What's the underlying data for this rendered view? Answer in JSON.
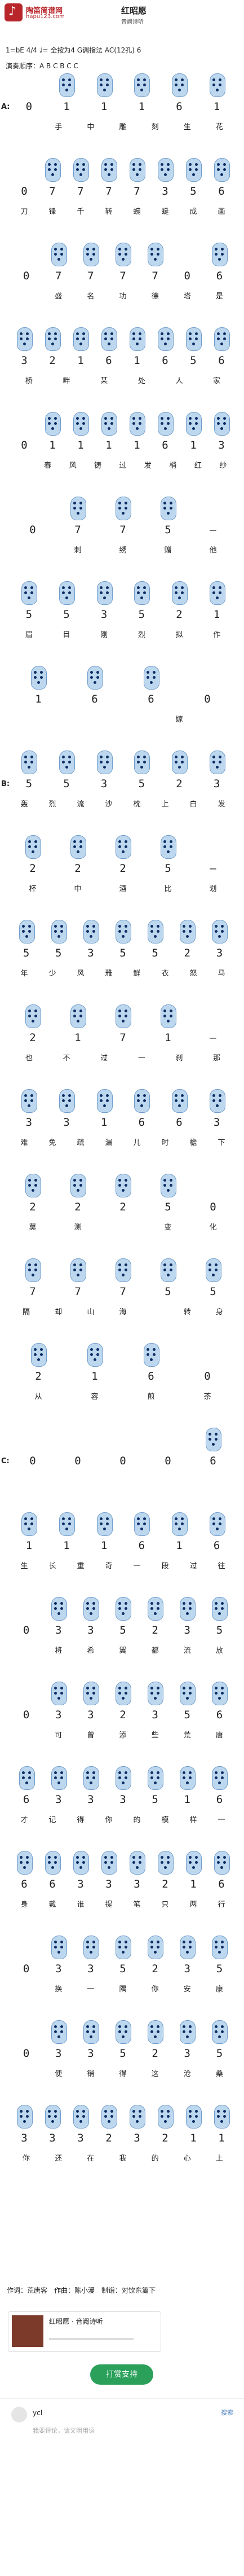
{
  "header": {
    "logo_text": "陶笛简谱网",
    "logo_url_text": "hapu123.com",
    "title": "红昭愿",
    "subtitle": "音阙诗听"
  },
  "meta": {
    "key_line": "1=bE 4/4 ♩= 全按为4 G调指法 AC(12孔) 6",
    "order_line": "演奏顺序：A B C B C C"
  },
  "sections": [
    {
      "label": "A:",
      "rows": [
        {
          "notes": [
            "0",
            "1",
            "1",
            "1",
            "6",
            "1"
          ],
          "lyrics": [
            "",
            "手",
            "中",
            "雕",
            "刻",
            "生",
            "花"
          ]
        },
        {
          "notes": [
            "0",
            "7",
            "7",
            "7",
            "7",
            "3",
            "5",
            "6"
          ],
          "lyrics": [
            "刀",
            "锋",
            "千",
            "转",
            "蜿",
            "蜒",
            "成",
            "画"
          ]
        },
        {
          "notes": [
            "0",
            "7",
            "7",
            "7",
            "7",
            "0",
            "6"
          ],
          "lyrics": [
            "",
            "盛",
            "名",
            "功",
            "德",
            "塔",
            "是"
          ]
        },
        {
          "notes": [
            "3",
            "2",
            "1",
            "6",
            "1",
            "6",
            "5",
            "6"
          ],
          "lyrics": [
            "桥",
            "畔",
            "某",
            "处",
            "人",
            "家"
          ]
        },
        {
          "notes": [
            "0",
            "1",
            "1",
            "1",
            "1",
            "6",
            "1",
            "3"
          ],
          "lyrics": [
            "",
            "春",
            "风",
            "铸",
            "过",
            "发",
            "梢",
            "红",
            "纱"
          ]
        },
        {
          "notes": [
            "0",
            "7",
            "7",
            "5",
            "–"
          ],
          "lyrics": [
            "",
            "刺",
            "绣",
            "赠",
            "他"
          ]
        },
        {
          "notes": [
            "5",
            "5",
            "3",
            "5",
            "2",
            "1"
          ],
          "lyrics": [
            "眉",
            "目",
            "刚",
            "烈",
            "拟",
            "作"
          ]
        },
        {
          "notes": [
            "1",
            "6",
            "6",
            "0"
          ],
          "lyrics": [
            "",
            "嫁"
          ]
        }
      ]
    },
    {
      "label": "B:",
      "rows": [
        {
          "notes": [
            "5",
            "5",
            "3",
            "5",
            "2",
            "3"
          ],
          "lyrics": [
            "轰",
            "烈",
            "流",
            "沙",
            "枕",
            "上",
            "白",
            "发"
          ]
        },
        {
          "notes": [
            "2",
            "2",
            "2",
            "5",
            "–"
          ],
          "lyrics": [
            "杯",
            "中",
            "酒",
            "比",
            "划"
          ]
        },
        {
          "notes": [
            "5",
            "5",
            "3",
            "5",
            "5",
            "2",
            "3"
          ],
          "lyrics": [
            "年",
            "少",
            "风",
            "雅",
            "鲜",
            "衣",
            "怒",
            "马"
          ]
        },
        {
          "notes": [
            "2",
            "1",
            "7",
            "1",
            "–"
          ],
          "lyrics": [
            "也",
            "不",
            "过",
            "一",
            "刹",
            "那"
          ]
        },
        {
          "notes": [
            "3",
            "3",
            "1",
            "6",
            "6",
            "3"
          ],
          "lyrics": [
            "难",
            "免",
            "疏",
            "漏",
            "儿",
            "时",
            "檐",
            "下"
          ]
        },
        {
          "notes": [
            "2",
            "2",
            "2",
            "5",
            "0"
          ],
          "lyrics": [
            "莫",
            "测",
            "",
            "变",
            "化"
          ]
        },
        {
          "notes": [
            "7",
            "7",
            "7",
            "5",
            "5"
          ],
          "lyrics": [
            "隔",
            "却",
            "山",
            "海",
            "",
            "转",
            "身"
          ]
        },
        {
          "notes": [
            "2",
            "1",
            "6",
            "0"
          ],
          "lyrics": [
            "从",
            "容",
            "煎",
            "茶"
          ]
        }
      ]
    },
    {
      "label": "C:",
      "rows": [
        {
          "notes": [
            "0",
            "0",
            "0",
            "0",
            "6"
          ],
          "lyrics": []
        },
        {
          "notes": [
            "1",
            "1",
            "1",
            "6",
            "1",
            "6"
          ],
          "lyrics": [
            "生",
            "长",
            "重",
            "奇",
            "一",
            "段",
            "过",
            "往"
          ]
        },
        {
          "notes": [
            "0",
            "3",
            "3",
            "5",
            "2",
            "3",
            "5"
          ],
          "lyrics": [
            "",
            "将",
            "希",
            "翼",
            "都",
            "流",
            "放"
          ]
        },
        {
          "notes": [
            "0",
            "3",
            "3",
            "2",
            "3",
            "5",
            "6"
          ],
          "lyrics": [
            "",
            "可",
            "曾",
            "添",
            "些",
            "荒",
            "唐"
          ]
        },
        {
          "notes": [
            "6",
            "3",
            "3",
            "3",
            "5",
            "1",
            "6"
          ],
          "lyrics": [
            "才",
            "记",
            "得",
            "你",
            "的",
            "模",
            "样",
            "一"
          ]
        },
        {
          "notes": [
            "6",
            "6",
            "3",
            "3",
            "3",
            "2",
            "1",
            "6"
          ],
          "lyrics": [
            "身",
            "戴",
            "谁",
            "提",
            "笔",
            "只",
            "两",
            "行"
          ]
        },
        {
          "notes": [
            "0",
            "3",
            "3",
            "5",
            "2",
            "3",
            "5"
          ],
          "lyrics": [
            "",
            "换",
            "一",
            "隅",
            "你",
            "安",
            "康"
          ]
        },
        {
          "notes": [
            "0",
            "3",
            "3",
            "5",
            "2",
            "3",
            "5"
          ],
          "lyrics": [
            "",
            "便",
            "销",
            "得",
            "这",
            "沧",
            "桑"
          ]
        },
        {
          "notes": [
            "3",
            "3",
            "3",
            "2",
            "3",
            "2",
            "1",
            "1"
          ],
          "lyrics": [
            "你",
            "还",
            "在",
            "我",
            "的",
            "心",
            "上"
          ]
        }
      ]
    }
  ],
  "credits": "作词：荒唐客　作曲：陈小漫　制谱：对饮东篱下",
  "player": {
    "title": "红昭愿",
    "artist": "音阙诗听"
  },
  "support_label": "打赏支持",
  "comment": {
    "user": "ycl",
    "button": "搜索",
    "placeholder": "我要评论，请文明用语"
  }
}
